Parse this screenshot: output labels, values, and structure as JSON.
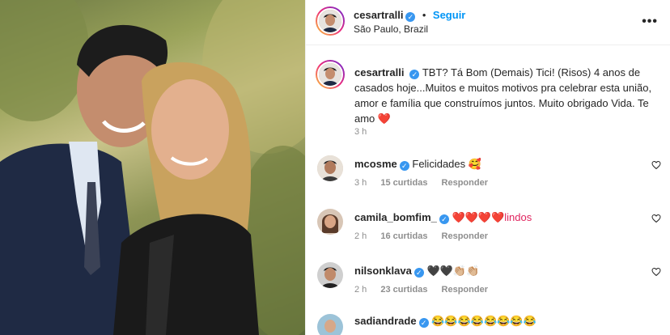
{
  "header": {
    "username": "cesartralli",
    "follow_label": "Seguir",
    "location": "São Paulo, Brazil",
    "more_label": "•••"
  },
  "caption": {
    "username": "cesartralli",
    "text": "TBT? Tá Bom (Demais) Tici! (Risos) 4 anos de casados hoje...Muitos e muitos motivos pra celebrar esta união, amor e família que construímos juntos. Muito obrigado Vida. Te amo ❤️",
    "time": "3 h"
  },
  "comments": [
    {
      "username": "mcosme",
      "verified": true,
      "text": "Felicidades 🥰",
      "time": "3 h",
      "likes": "15 curtidas",
      "reply": "Responder"
    },
    {
      "username": "camila_bomfim_",
      "verified": true,
      "text": "❤️❤️❤️❤️lindos",
      "time": "2 h",
      "likes": "16 curtidas",
      "reply": "Responder"
    },
    {
      "username": "nilsonklava",
      "verified": true,
      "text": "🖤🖤👏🏼👏🏼",
      "time": "2 h",
      "likes": "23 curtidas",
      "reply": "Responder"
    }
  ],
  "partial_comment": {
    "username": "sadiandrade",
    "text": "😂😂😂😂😂😂😂😂"
  },
  "colors": {
    "accent": "#0095f6",
    "verified": "#3897f0",
    "muted": "#8e8e8e"
  }
}
